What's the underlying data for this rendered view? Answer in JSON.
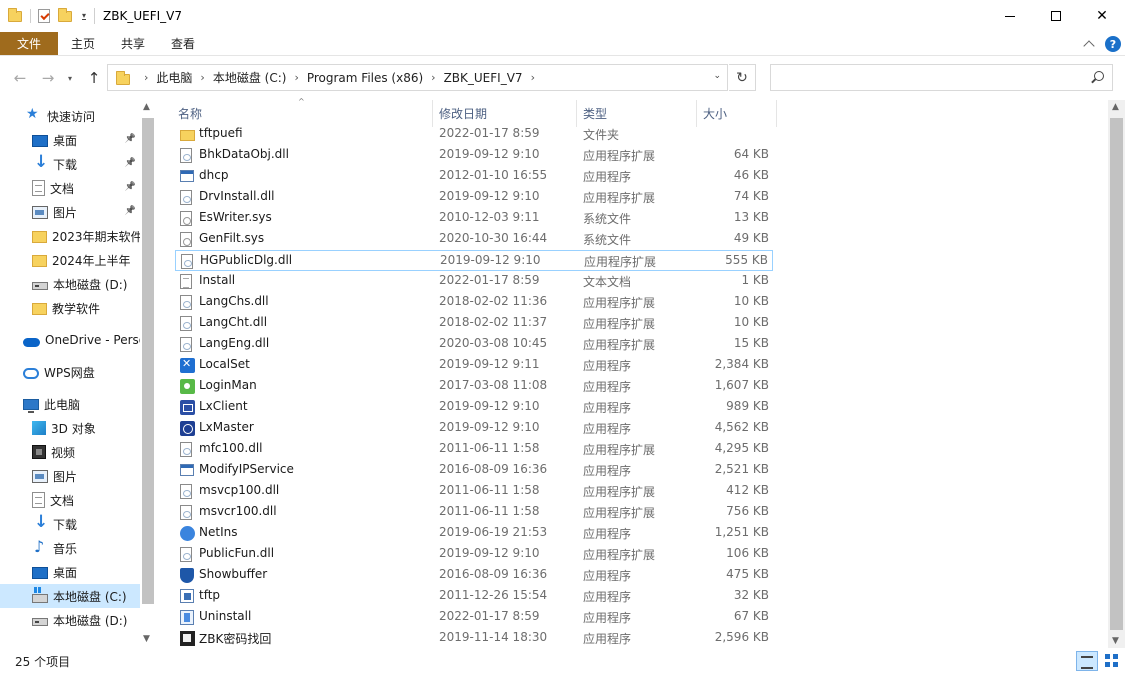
{
  "window": {
    "title": "ZBK_UEFI_V7",
    "minimize_glyph": "",
    "close_glyph": "✕"
  },
  "ribbon": {
    "tabs": [
      "文件",
      "主页",
      "共享",
      "查看"
    ],
    "help_glyph": "?"
  },
  "address": {
    "breadcrumbs": [
      "此电脑",
      "本地磁盘 (C:)",
      "Program Files (x86)",
      "ZBK_UEFI_V7"
    ],
    "search_placeholder": ""
  },
  "sidebar": {
    "items": [
      {
        "label": "快速访问",
        "icon": "star-icon",
        "pinned": false
      },
      {
        "label": "桌面",
        "icon": "desktop-icon",
        "pinned": true
      },
      {
        "label": "下载",
        "icon": "download-icon",
        "pinned": true
      },
      {
        "label": "文档",
        "icon": "document-icon",
        "pinned": true
      },
      {
        "label": "图片",
        "icon": "picture-icon",
        "pinned": true
      },
      {
        "label": "2023年期末软件",
        "icon": "folder-icon",
        "pinned": false
      },
      {
        "label": "2024年上半年",
        "icon": "folder-icon",
        "pinned": false
      },
      {
        "label": "本地磁盘 (D:)",
        "icon": "drive-icon",
        "pinned": false
      },
      {
        "label": "教学软件",
        "icon": "folder-icon",
        "pinned": false
      },
      {
        "label": "OneDrive - Personal",
        "icon": "onedrive-icon",
        "pinned": false
      },
      {
        "label": "WPS网盘",
        "icon": "wps-cloud-icon",
        "pinned": false
      },
      {
        "label": "此电脑",
        "icon": "this-pc-icon",
        "pinned": false
      },
      {
        "label": "3D 对象",
        "icon": "3d-objects-icon",
        "pinned": false
      },
      {
        "label": "视频",
        "icon": "video-icon",
        "pinned": false
      },
      {
        "label": "图片",
        "icon": "picture-icon",
        "pinned": false
      },
      {
        "label": "文档",
        "icon": "document-icon",
        "pinned": false
      },
      {
        "label": "下载",
        "icon": "download-icon",
        "pinned": false
      },
      {
        "label": "音乐",
        "icon": "music-icon",
        "pinned": false
      },
      {
        "label": "桌面",
        "icon": "desktop-icon",
        "pinned": false
      },
      {
        "label": "本地磁盘 (C:)",
        "icon": "drive-c-icon",
        "pinned": false,
        "selected": true
      },
      {
        "label": "本地磁盘 (D:)",
        "icon": "drive-icon",
        "pinned": false
      }
    ]
  },
  "columns": {
    "name": "名称",
    "date": "修改日期",
    "type": "类型",
    "size": "大小"
  },
  "files": [
    {
      "name": "tftpuefi",
      "date": "2022-01-17 8:59",
      "type": "文件夹",
      "size": "",
      "icon": "folder"
    },
    {
      "name": "BhkDataObj.dll",
      "date": "2019-09-12 9:10",
      "type": "应用程序扩展",
      "size": "64 KB",
      "icon": "dll"
    },
    {
      "name": "dhcp",
      "date": "2012-01-10 16:55",
      "type": "应用程序",
      "size": "46 KB",
      "icon": "exe"
    },
    {
      "name": "DrvInstall.dll",
      "date": "2019-09-12 9:10",
      "type": "应用程序扩展",
      "size": "74 KB",
      "icon": "dll"
    },
    {
      "name": "EsWriter.sys",
      "date": "2010-12-03 9:11",
      "type": "系统文件",
      "size": "13 KB",
      "icon": "sys"
    },
    {
      "name": "GenFilt.sys",
      "date": "2020-10-30 16:44",
      "type": "系统文件",
      "size": "49 KB",
      "icon": "sys"
    },
    {
      "name": "HGPublicDlg.dll",
      "date": "2019-09-12 9:10",
      "type": "应用程序扩展",
      "size": "555 KB",
      "icon": "dll",
      "focused": true
    },
    {
      "name": "Install",
      "date": "2022-01-17 8:59",
      "type": "文本文档",
      "size": "1 KB",
      "icon": "txt"
    },
    {
      "name": "LangChs.dll",
      "date": "2018-02-02 11:36",
      "type": "应用程序扩展",
      "size": "10 KB",
      "icon": "dll"
    },
    {
      "name": "LangCht.dll",
      "date": "2018-02-02 11:37",
      "type": "应用程序扩展",
      "size": "10 KB",
      "icon": "dll"
    },
    {
      "name": "LangEng.dll",
      "date": "2020-03-08 10:45",
      "type": "应用程序扩展",
      "size": "15 KB",
      "icon": "dll"
    },
    {
      "name": "LocalSet",
      "date": "2019-09-12 9:11",
      "type": "应用程序",
      "size": "2,384 KB",
      "icon": "local"
    },
    {
      "name": "LoginMan",
      "date": "2017-03-08 11:08",
      "type": "应用程序",
      "size": "1,607 KB",
      "icon": "login"
    },
    {
      "name": "LxClient",
      "date": "2019-09-12 9:10",
      "type": "应用程序",
      "size": "989 KB",
      "icon": "lxc"
    },
    {
      "name": "LxMaster",
      "date": "2019-09-12 9:10",
      "type": "应用程序",
      "size": "4,562 KB",
      "icon": "lxm"
    },
    {
      "name": "mfc100.dll",
      "date": "2011-06-11 1:58",
      "type": "应用程序扩展",
      "size": "4,295 KB",
      "icon": "dll"
    },
    {
      "name": "ModifyIPService",
      "date": "2016-08-09 16:36",
      "type": "应用程序",
      "size": "2,521 KB",
      "icon": "exe"
    },
    {
      "name": "msvcp100.dll",
      "date": "2011-06-11 1:58",
      "type": "应用程序扩展",
      "size": "412 KB",
      "icon": "dll"
    },
    {
      "name": "msvcr100.dll",
      "date": "2011-06-11 1:58",
      "type": "应用程序扩展",
      "size": "756 KB",
      "icon": "dll"
    },
    {
      "name": "NetIns",
      "date": "2019-06-19 21:53",
      "type": "应用程序",
      "size": "1,251 KB",
      "icon": "netins"
    },
    {
      "name": "PublicFun.dll",
      "date": "2019-09-12 9:10",
      "type": "应用程序扩展",
      "size": "106 KB",
      "icon": "dll"
    },
    {
      "name": "Showbuffer",
      "date": "2016-08-09 16:36",
      "type": "应用程序",
      "size": "475 KB",
      "icon": "shield"
    },
    {
      "name": "tftp",
      "date": "2011-12-26 15:54",
      "type": "应用程序",
      "size": "32 KB",
      "icon": "tftp"
    },
    {
      "name": "Uninstall",
      "date": "2022-01-17 8:59",
      "type": "应用程序",
      "size": "67 KB",
      "icon": "uninst"
    },
    {
      "name": "ZBK密码找回",
      "date": "2019-11-14 18:30",
      "type": "应用程序",
      "size": "2,596 KB",
      "icon": "zbk"
    }
  ],
  "status": {
    "item_count": "25 个项目"
  }
}
